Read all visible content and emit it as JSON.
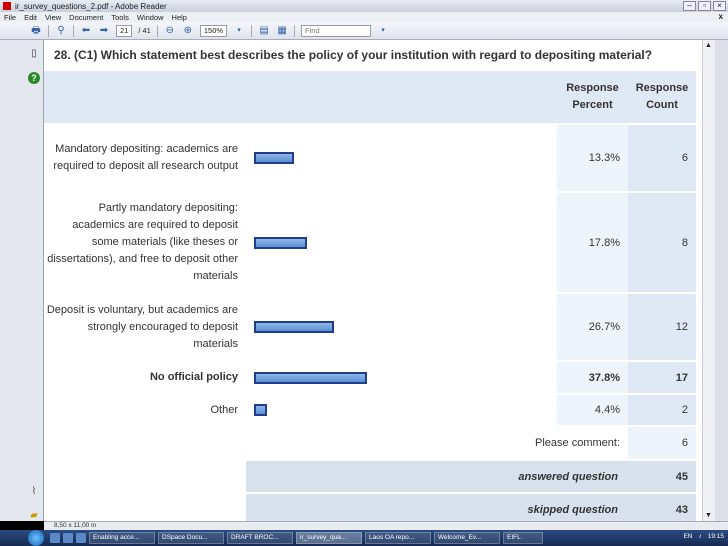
{
  "window": {
    "title": "ir_survey_questions_2.pdf - Adobe Reader"
  },
  "menu": {
    "items": [
      "File",
      "Edit",
      "View",
      "Document",
      "Tools",
      "Window",
      "Help"
    ],
    "close": "x"
  },
  "toolbar": {
    "page_current": "21",
    "page_total": "/ 41",
    "zoom": "150%",
    "find_placeholder": "Find"
  },
  "document": {
    "question": "28. (C1) Which statement best describes the policy of your institution with regard to depositing material?",
    "header": {
      "percent": "Response Percent",
      "count": "Response Count"
    },
    "rows": [
      {
        "label": "Mandatory depositing: academics are required to deposit all research output",
        "percent": "13.3%",
        "count": "6",
        "fraction": 0.133,
        "bold": false
      },
      {
        "label": "Partly mandatory depositing: academics are required to deposit some materials (like theses or dissertations), and free to deposit other materials",
        "percent": "17.8%",
        "count": "8",
        "fraction": 0.178,
        "bold": false
      },
      {
        "label": "Deposit is voluntary, but academics are strongly encouraged to deposit materials",
        "percent": "26.7%",
        "count": "12",
        "fraction": 0.267,
        "bold": false
      },
      {
        "label": "No official policy",
        "percent": "37.8%",
        "count": "17",
        "fraction": 0.378,
        "bold": true
      },
      {
        "label": "Other",
        "percent": "4.4%",
        "count": "2",
        "fraction": 0.044,
        "bold": false
      }
    ],
    "comment": {
      "label": "Please comment:",
      "count": "6"
    },
    "answered": {
      "label": "answered question",
      "count": "45"
    },
    "skipped": {
      "label": "skipped question",
      "count": "43"
    }
  },
  "status": {
    "page_size": "8,50 x 11,00 in"
  },
  "taskbar": {
    "tasks": [
      "Enabling acce...",
      "DSpace Docu...",
      "DRAFT BROC...",
      "ir_survey_qua...",
      "Laos OA repo...",
      "Welcome_Ev...",
      "EIFL"
    ],
    "lang": "EN",
    "clock": "19:15"
  }
}
